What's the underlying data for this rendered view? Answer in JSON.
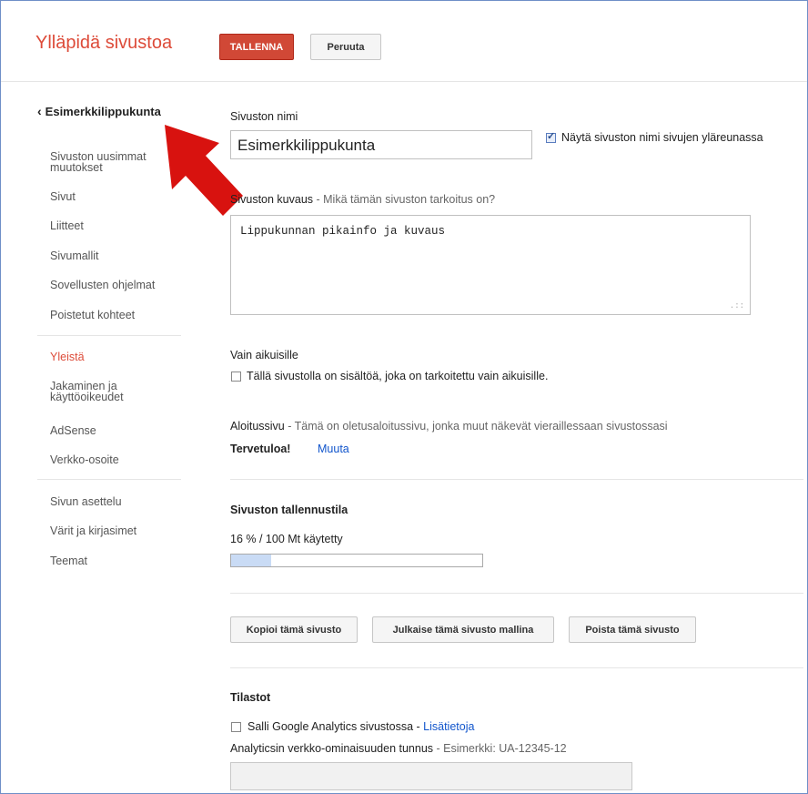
{
  "header": {
    "title": "Ylläpidä sivustoa",
    "save_label": "TALLENNA",
    "cancel_label": "Peruuta"
  },
  "sidebar": {
    "back_label": "Esimerkkilippukunta",
    "group1": [
      "Sivuston uusimmat muutokset",
      "Sivut",
      "Liitteet",
      "Sivumallit",
      "Sovellusten ohjelmat",
      "Poistetut kohteet"
    ],
    "group2": [
      "Yleistä",
      "Jakaminen ja käyttöoikeudet",
      "AdSense",
      "Verkko-osoite"
    ],
    "group3": [
      "Sivun asettelu",
      "Värit ja kirjasimet",
      "Teemat"
    ],
    "active": "Yleistä"
  },
  "main": {
    "site_name_label": "Sivuston nimi",
    "site_name_value": "Esimerkkilippukunta",
    "show_name_label": "Näytä sivuston nimi sivujen yläreunassa",
    "show_name_checked": true,
    "desc_label": "Sivuston kuvaus",
    "desc_hint": " - Mikä tämän sivuston tarkoitus on?",
    "desc_value": "Lippukunnan pikainfo ja kuvaus",
    "adults_heading": "Vain aikuisille",
    "adults_label": "Tällä sivustolla on sisältöä, joka on tarkoitettu vain aikuisille.",
    "adults_checked": false,
    "landing_label": "Aloitussivu",
    "landing_hint": " - Tämä on oletusaloitussivu, jonka muut näkevät vieraillessaan sivustossasi",
    "landing_page": "Tervetuloa!",
    "landing_change": "Muuta",
    "storage_heading": "Sivuston tallennustila",
    "storage_text": "16 % / 100 Mt käytetty",
    "storage_percent": 16,
    "copy_button": "Kopioi tämä sivusto",
    "publish_button": "Julkaise tämä sivusto mallina",
    "delete_button": "Poista tämä sivusto",
    "stats_heading": "Tilastot",
    "analytics_label": "Salli Google Analytics sivustossa",
    "analytics_sep": " - ",
    "analytics_link": "Lisätietoja",
    "analytics_checked": false,
    "tracking_label": "Analyticsin verkko-ominaisuuden tunnus",
    "tracking_hint": " - Esimerkki: UA-12345-12",
    "tracking_value": ""
  },
  "colors": {
    "brand_red": "#dd4b39",
    "link_blue": "#1155cc",
    "annotation_arrow": "#d8120f"
  }
}
